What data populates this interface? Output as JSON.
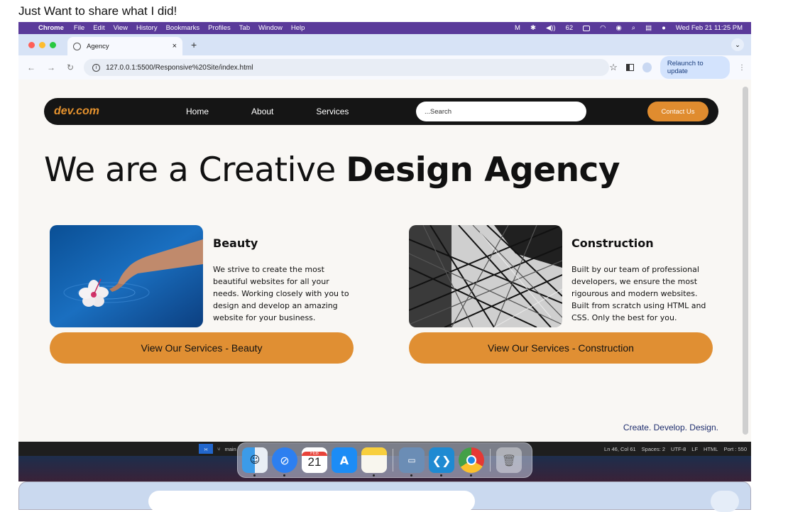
{
  "caption": "Just Want to share what I did!",
  "menubar": {
    "app": "Chrome",
    "items": [
      "File",
      "Edit",
      "View",
      "History",
      "Bookmarks",
      "Profiles",
      "Tab",
      "Window",
      "Help"
    ],
    "clock": "Wed Feb 21  11:25 PM",
    "battery": "62"
  },
  "browser": {
    "tab_title": "Agency",
    "url": "127.0.0.1:5500/Responsive%20Site/index.html",
    "relaunch_label": "Relaunch to update"
  },
  "site": {
    "logo": "dev.com",
    "nav": [
      "Home",
      "About",
      "Services"
    ],
    "search_placeholder": "...Search",
    "contact_label": "Contact Us",
    "hero_regular": "We are a Creative ",
    "hero_bold": "Design Agency",
    "cards": [
      {
        "title": "Beauty",
        "text": "We strive to create the most beautiful websites for all your needs. Working closely with you to design and develop an amazing website for your business.",
        "button": "View Our Services - Beauty"
      },
      {
        "title": "Construction",
        "text": "Built by our team of professional developers, we ensure the most rigourous and modern websites. Built from scratch using HTML and CSS. Only the best for you.",
        "button": "View Our Services - Construction"
      }
    ],
    "tagline": "Create. Develop. Design."
  },
  "editor_status": {
    "branch": "main",
    "position": "Ln 46, Col 61",
    "spaces": "Spaces: 2",
    "encoding": "UTF-8",
    "eol": "LF",
    "language": "HTML",
    "port": "Port : 550"
  },
  "dock": {
    "calendar_month": "FEB",
    "calendar_day": "21"
  }
}
